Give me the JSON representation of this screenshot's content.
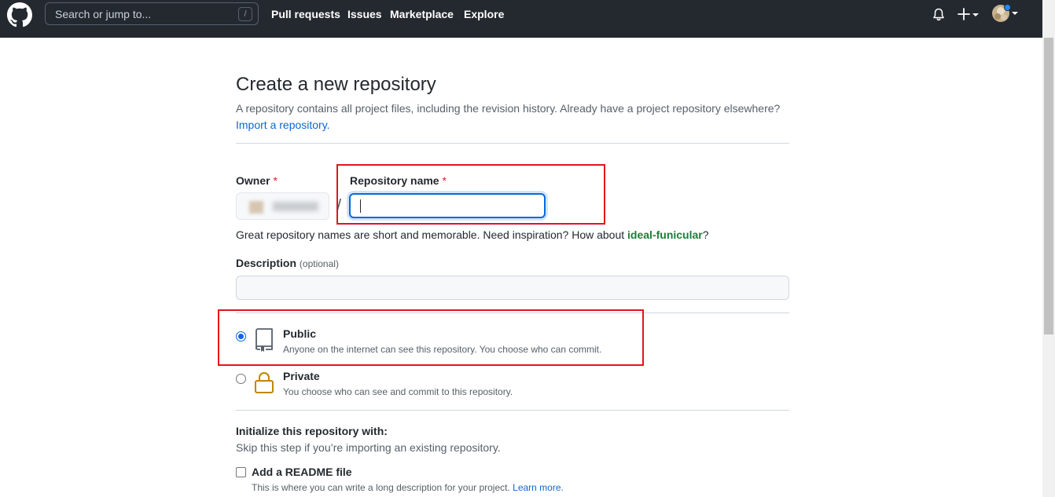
{
  "header": {
    "search_placeholder": "Search or jump to...",
    "search_shortcut": "/",
    "nav": [
      "Pull requests",
      "Issues",
      "Marketplace",
      "Explore"
    ]
  },
  "page": {
    "title": "Create a new repository",
    "subtitle": "A repository contains all project files, including the revision history. Already have a project repository elsewhere?",
    "import_link": "Import a repository."
  },
  "form": {
    "owner_label": "Owner",
    "required_mark": "*",
    "separator": "/",
    "repo_name_label": "Repository name",
    "repo_name_value": "",
    "hint_prefix": "Great repository names are short and memorable. Need inspiration? How about ",
    "hint_suggestion": "ideal-funicular",
    "hint_suffix": "?",
    "description_label": "Description",
    "description_optional": "(optional)",
    "description_value": ""
  },
  "visibility": [
    {
      "title": "Public",
      "description": "Anyone on the internet can see this repository. You choose who can commit.",
      "checked": true,
      "icon": "repo-icon"
    },
    {
      "title": "Private",
      "description": "You choose who can see and commit to this repository.",
      "checked": false,
      "icon": "lock-icon"
    }
  ],
  "initialize": {
    "title": "Initialize this repository with:",
    "subtitle": "Skip this step if you’re importing an existing repository.",
    "readme_label": "Add a README file",
    "readme_desc": "This is where you can write a long description for your project. ",
    "readme_link": "Learn more.",
    "readme_checked": false
  },
  "colors": {
    "header_bg": "#24292f",
    "link": "#0969da",
    "required": "#cf222e",
    "suggestion": "#1a7f37",
    "highlight_box": "#e3141c"
  }
}
